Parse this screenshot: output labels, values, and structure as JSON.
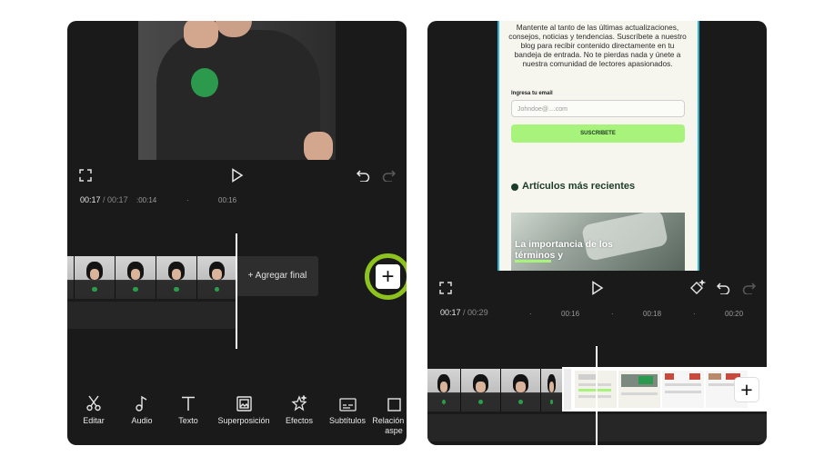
{
  "left": {
    "timecode": {
      "current": "00:17",
      "sep": " / ",
      "total": "00:17"
    },
    "ruler": [
      ":00:14",
      "·",
      "00:16"
    ],
    "add_end_label": "+  Agregar final",
    "add_clip_symbol": "+",
    "tools": [
      {
        "label": "Editar",
        "icon": "scissors-icon"
      },
      {
        "label": "Audio",
        "icon": "music-note-icon"
      },
      {
        "label": "Texto",
        "icon": "text-icon"
      },
      {
        "label": "Superposición",
        "icon": "overlay-icon"
      },
      {
        "label": "Efectos",
        "icon": "effects-star-icon"
      },
      {
        "label": "Subtítulos",
        "icon": "captions-icon"
      },
      {
        "label": "Relación de aspe",
        "icon": "aspect-ratio-icon"
      }
    ],
    "highlight_color": "#8dc21f"
  },
  "right": {
    "web": {
      "newsletter_text": "Mantente al tanto de las últimas actualizaciones, consejos, noticias y tendencias. Suscríbete a nuestro blog para recibir contenido directamente en tu bandeja de entrada. No te pierdas nada y únete a nuestra comunidad de lectores apasionados.",
      "email_label": "Ingresa tu email",
      "email_placeholder": "Johndoe@....com",
      "subscribe_label": "SUSCRIBETE",
      "section_title": "Artículos más recientes",
      "card_title": "La importancia de los términos y"
    },
    "timecode": {
      "current": "00:17",
      "sep": " / ",
      "total": "00:29"
    },
    "ruler": [
      "·",
      "00:16",
      "·",
      "00:18",
      "·",
      "00:20"
    ],
    "add_clip_symbol": "+",
    "accent_color": "#a7f37c"
  }
}
